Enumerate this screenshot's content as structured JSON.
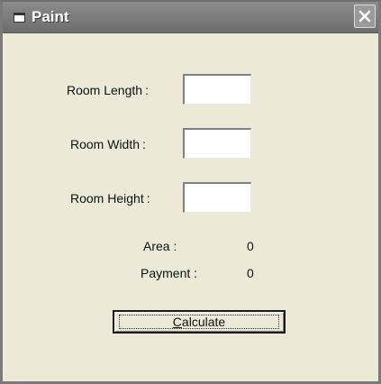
{
  "window": {
    "title": "Paint"
  },
  "form": {
    "length_label": "Room  Length",
    "width_label": "Room  Width",
    "height_label": "Room  Height",
    "colon": ":",
    "length_value": "",
    "width_value": "",
    "height_value": ""
  },
  "results": {
    "area_label": "Area :",
    "area_value": "0",
    "payment_label": "Payment :",
    "payment_value": "0"
  },
  "actions": {
    "calculate_prefix": "C",
    "calculate_rest": "alculate"
  },
  "icons": {
    "window": "window-icon",
    "close": "close-icon"
  },
  "colors": {
    "titlebar": "#7a7a7a",
    "client": "#ece9d8"
  }
}
